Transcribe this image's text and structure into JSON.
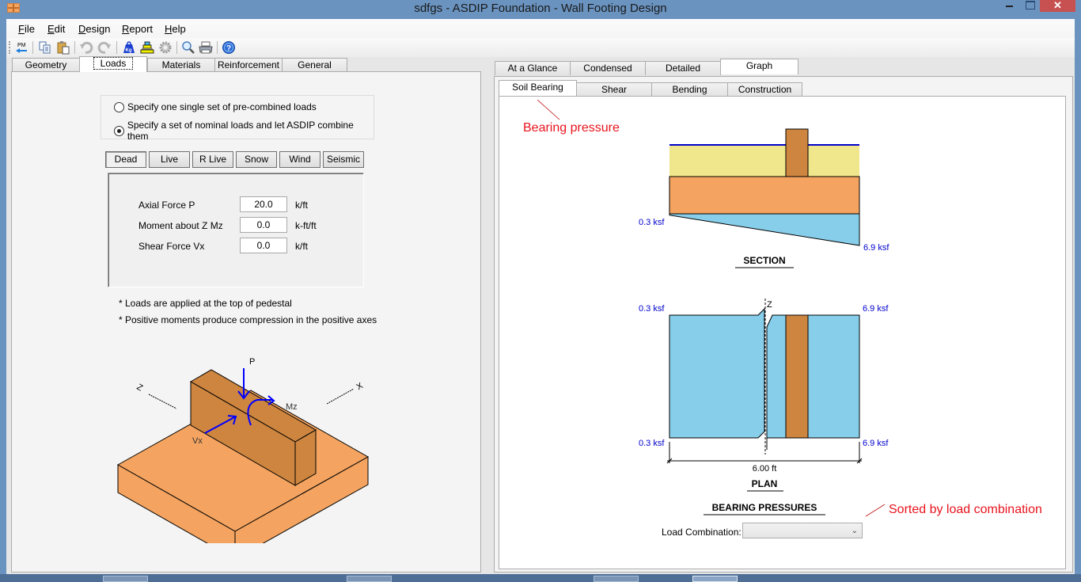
{
  "window": {
    "title": "sdfgs - ASDIP Foundation - Wall Footing Design",
    "close_glyph": "✕"
  },
  "menu": [
    {
      "label": "File",
      "mnemonic": "F",
      "rest": "ile"
    },
    {
      "label": "Edit",
      "mnemonic": "E",
      "rest": "dit"
    },
    {
      "label": "Design",
      "mnemonic": "D",
      "rest": "esign"
    },
    {
      "label": "Report",
      "mnemonic": "R",
      "rest": "eport"
    },
    {
      "label": "Help",
      "mnemonic": "H",
      "rest": "elp"
    }
  ],
  "toolbar": [
    {
      "icon": "pm-back-icon",
      "label": "PM"
    },
    {
      "icon": "copy-icon"
    },
    {
      "icon": "paste-icon"
    },
    {
      "icon": "undo-icon"
    },
    {
      "icon": "redo-icon"
    },
    {
      "icon": "weight-kg-icon",
      "label": "Kg"
    },
    {
      "icon": "stack-icon"
    },
    {
      "icon": "gear-icon"
    },
    {
      "icon": "zoom-icon"
    },
    {
      "icon": "print-icon"
    },
    {
      "icon": "help-icon",
      "label": "?"
    }
  ],
  "left_tabs": [
    {
      "label": "Geometry",
      "active": false
    },
    {
      "label": "Loads",
      "active": true
    },
    {
      "label": "Materials",
      "active": false
    },
    {
      "label": "Reinforcement",
      "active": false
    },
    {
      "label": "General",
      "active": false
    }
  ],
  "load_mode": {
    "options": [
      {
        "label": "Specify one single set of pre-combined loads",
        "checked": false
      },
      {
        "label": "Specify a set of nominal loads and let ASDIP combine them",
        "checked": true
      }
    ]
  },
  "load_types": [
    {
      "label": "Dead",
      "active": true
    },
    {
      "label": "Live",
      "active": false
    },
    {
      "label": "R Live",
      "active": false
    },
    {
      "label": "Snow",
      "active": false
    },
    {
      "label": "Wind",
      "active": false
    },
    {
      "label": "Seismic",
      "active": false
    }
  ],
  "loads": {
    "fields": [
      {
        "label": "Axial Force  P",
        "value": "20.0",
        "unit": "k/ft"
      },
      {
        "label": "Moment about Z  Mz",
        "value": "0.0",
        "unit": "k-ft/ft"
      },
      {
        "label": "Shear Force  Vx",
        "value": "0.0",
        "unit": "k/ft"
      }
    ],
    "notes": [
      "* Loads are applied at the top of pedestal",
      "* Positive moments produce compression in the positive axes"
    ]
  },
  "iso_diagram": {
    "labels": {
      "p": "P",
      "mz": "Mz",
      "vx": "Vx",
      "z": "Z",
      "x": "X"
    },
    "colors": {
      "footing": "#f4a460",
      "wall": "#cd853f",
      "arrows": "#0000ff"
    }
  },
  "right_tabs": [
    {
      "label": "At a Glance",
      "active": false
    },
    {
      "label": "Condensed",
      "active": false
    },
    {
      "label": "Detailed",
      "active": false
    },
    {
      "label": "Graph",
      "active": true
    }
  ],
  "graph_tabs": [
    {
      "label": "Soil Bearing",
      "active": true
    },
    {
      "label": "Shear",
      "active": false
    },
    {
      "label": "Bending",
      "active": false
    },
    {
      "label": "Construction",
      "active": false
    }
  ],
  "annotations": {
    "bearing": "Bearing pressure",
    "sorted": "Sorted by load combination"
  },
  "section": {
    "title": "SECTION",
    "left_pressure": "0.3 ksf",
    "right_pressure": "6.9 ksf",
    "pressure_left_ksf": 0.3,
    "pressure_right_ksf": 6.9
  },
  "plan": {
    "title": "PLAN",
    "top_left": "0.3 ksf",
    "top_right": "6.9 ksf",
    "bottom_left": "0.3 ksf",
    "bottom_right": "6.9 ksf",
    "axis_label": "Z",
    "width_dim": "6.00 ft"
  },
  "bearing_pressures": {
    "title": "BEARING PRESSURES",
    "combo_label": "Load Combination:",
    "combo_value": ""
  },
  "colors": {
    "soil": "#f0e68c",
    "footing": "#f4a460",
    "wall": "#cd853f",
    "pressure": "#87ceeb",
    "grade_line": "#0000cd",
    "dim_text": "#0000cd",
    "annotation": "#e8141e"
  }
}
